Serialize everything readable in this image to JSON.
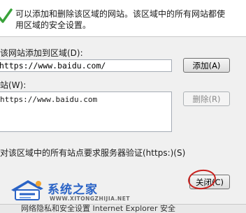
{
  "info": {
    "line1": "可以添加和删除该区域的网站。该区域中的所有网站都使",
    "line2": "用区域的安全设置。"
  },
  "add_section": {
    "label": "该网站添加到区域(D):",
    "input_value": "https://www.baidu.com/",
    "add_button": "添加(A)"
  },
  "sites_section": {
    "label": "站(W):",
    "items": [
      "https://www.baidu.com"
    ],
    "remove_button": "删除(R)"
  },
  "verify_checkbox": {
    "label": "对该区域中的所有站点要求服务器验证(https:)(S)"
  },
  "close_button": "关闭(C)",
  "watermark": {
    "title": "系统之家",
    "url": "WWW.XITONGZHIJIA.NET"
  },
  "bottom_text": "网络隐私和安全设置 Internet Explorer 安全",
  "colors": {
    "accent_red": "#c9211e",
    "watermark_blue": "#2a63c6",
    "check_green": "#39a23a"
  }
}
